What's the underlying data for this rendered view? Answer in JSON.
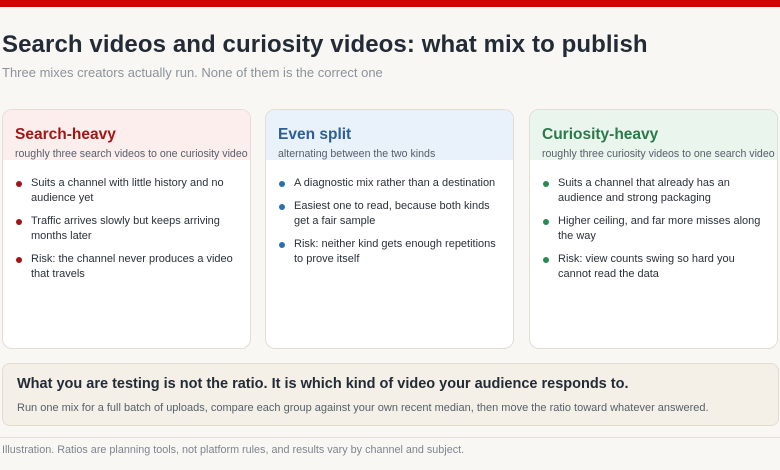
{
  "accent": "#cc0000",
  "title": "Search videos and curiosity videos: what mix to publish",
  "subtitle": "Three mixes creators actually run. None of them is the correct one",
  "cards": [
    {
      "title": "Search-heavy",
      "subtitle": "roughly three search videos to one curiosity video",
      "title_color": "#a31515",
      "header_bg": "#fdeeee",
      "dot_color": "#a31515",
      "items": [
        "Suits a channel with little history and no audience yet",
        "Traffic arrives slowly but keeps arriving months later",
        "Risk: the channel never produces a video that travels"
      ]
    },
    {
      "title": "Even split",
      "subtitle": "alternating between the two kinds",
      "title_color": "#2c5f93",
      "header_bg": "#e9f1fa",
      "dot_color": "#2c6fb0",
      "items": [
        "A diagnostic mix rather than a destination",
        "Easiest one to read, because both kinds get a fair sample",
        "Risk: neither kind gets enough repetitions to prove itself"
      ]
    },
    {
      "title": "Curiosity-heavy",
      "subtitle": "roughly three curiosity videos to one search video",
      "title_color": "#2a7a4a",
      "header_bg": "#eaf5ee",
      "dot_color": "#2a8a55",
      "items": [
        "Suits a channel that already has an audience and strong packaging",
        "Higher ceiling, and far more misses along the way",
        "Risk: view counts swing so hard you cannot read the data"
      ]
    }
  ],
  "callout": {
    "title": "What you are testing is not the ratio. It is which kind of video your audience responds to.",
    "body": "Run one mix for a full batch of uploads, compare each group against your own recent median, then move the ratio toward whatever answered."
  },
  "footnote": "Illustration. Ratios are planning tools, not platform rules, and results vary by channel and subject."
}
